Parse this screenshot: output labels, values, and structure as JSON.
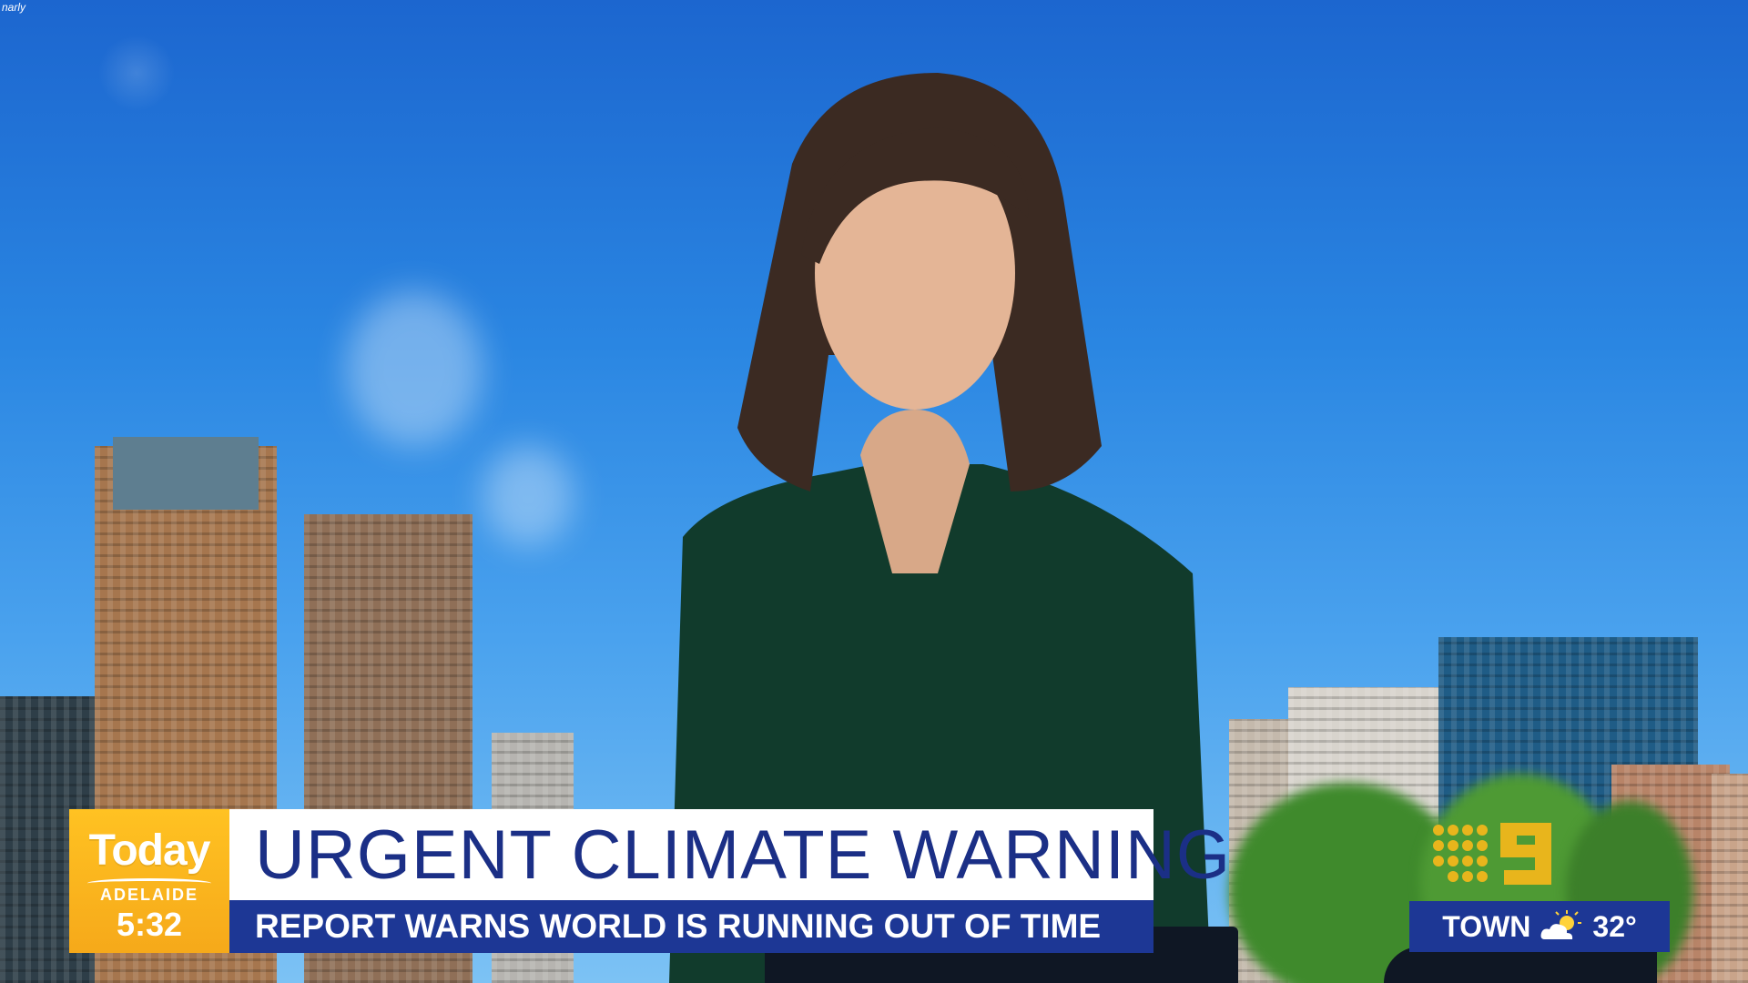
{
  "corner_tag": "narly",
  "program": {
    "logo_text": "Today",
    "city": "ADELAIDE",
    "time": "5:32"
  },
  "lower_third": {
    "headline": "URGENT CLIMATE WARNING",
    "subheadline": "REPORT WARNS WORLD IS RUNNING OUT OF TIME"
  },
  "weather": {
    "location": "TOWN",
    "icon": "partly-sunny-icon",
    "temperature": "32°"
  },
  "network_logo": "channel-9-logo",
  "colors": {
    "brand_yellow": "#f6a91a",
    "banner_navy": "#1d3795",
    "headline_text": "#1b2f86",
    "network_gold": "#e8b51c"
  }
}
